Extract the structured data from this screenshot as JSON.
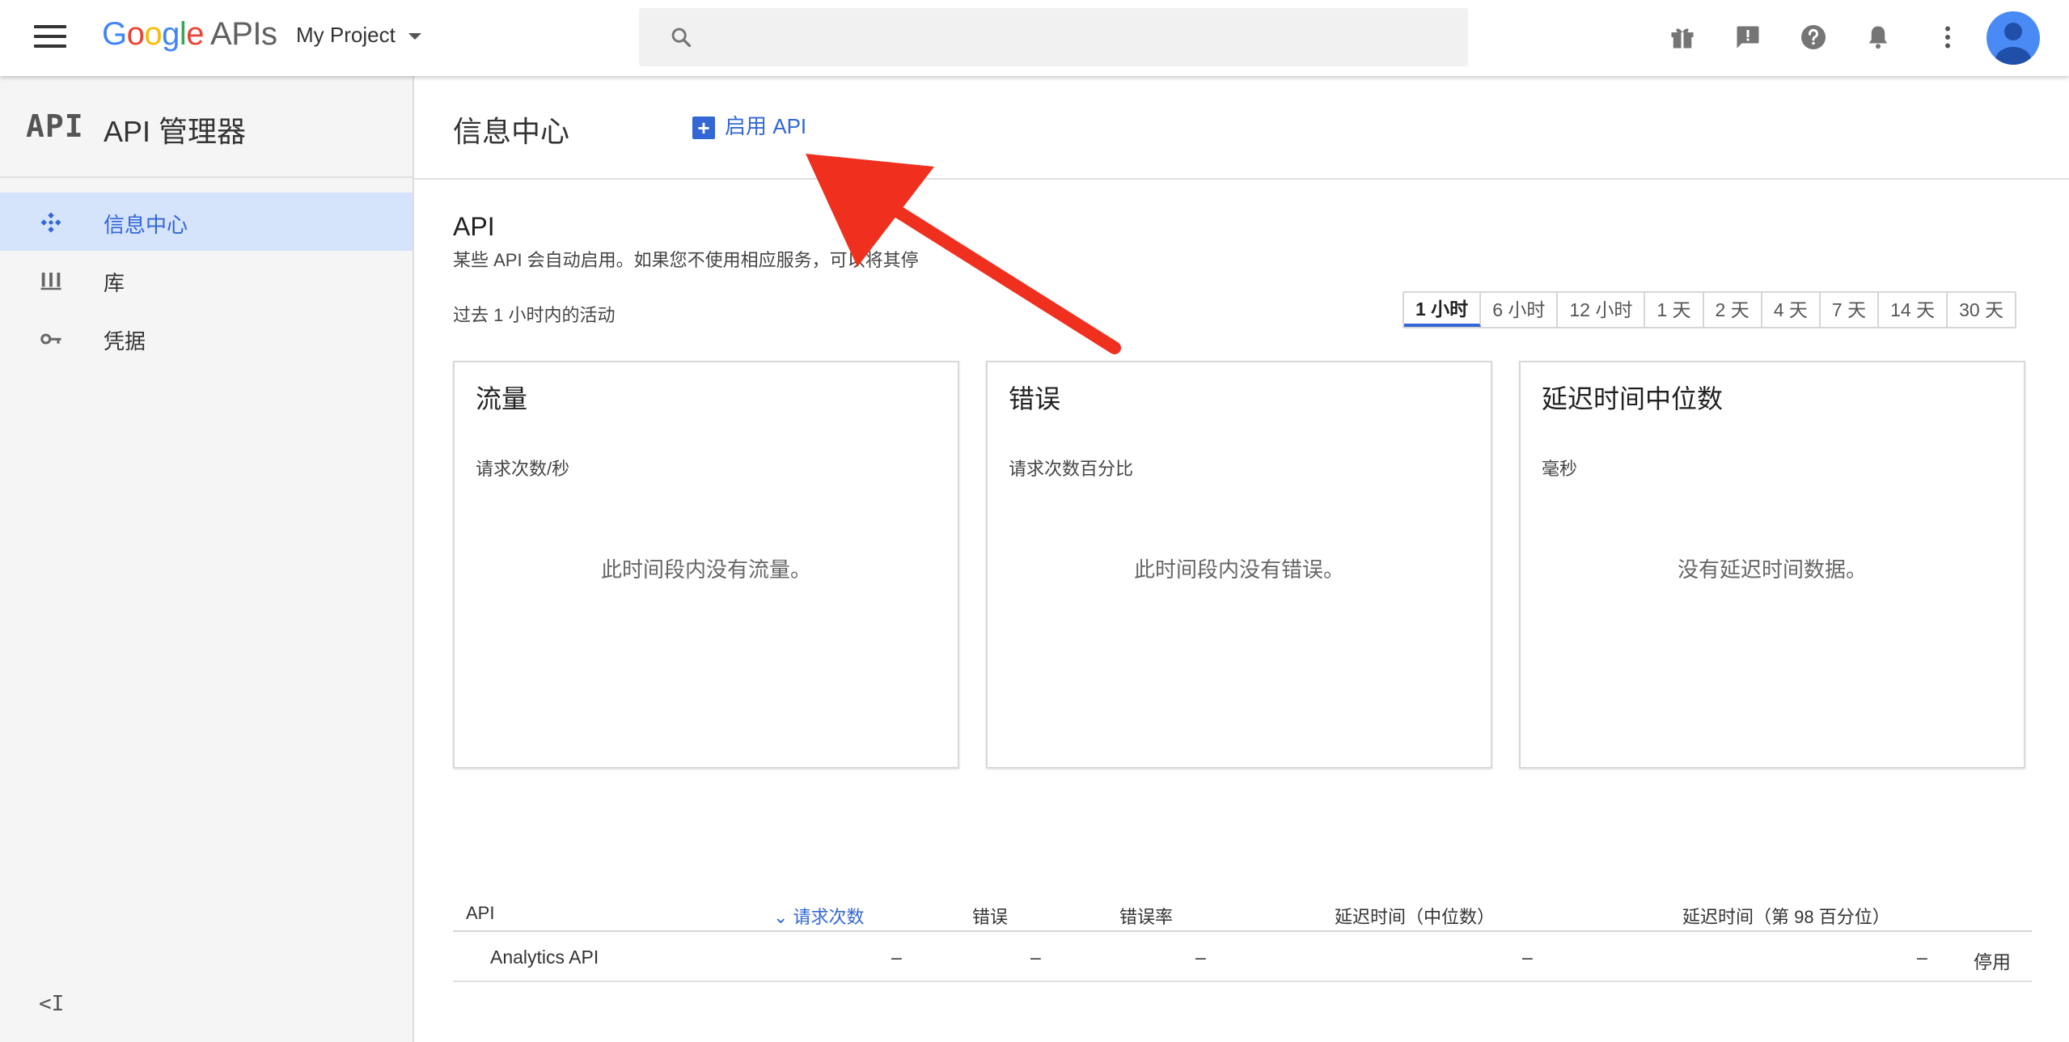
{
  "topbar": {
    "logo_google": "Google",
    "logo_apis": "APIs",
    "project_name": "My Project",
    "search_placeholder": "",
    "icons": [
      "gift-icon",
      "feedback-icon",
      "help-icon",
      "notifications-icon",
      "more-vert-icon",
      "account-icon"
    ]
  },
  "sidebar": {
    "api_badge": "API",
    "title": "API 管理器",
    "items": [
      {
        "label": "信息中心",
        "icon": "dashboard-icon",
        "active": true
      },
      {
        "label": "库",
        "icon": "library-icon",
        "active": false
      },
      {
        "label": "凭据",
        "icon": "key-icon",
        "active": false
      }
    ],
    "collapse_glyph": "<I"
  },
  "main": {
    "page_title": "信息中心",
    "enable_api_label": "启用 API",
    "section_title": "API",
    "section_subtitle": "某些 API 会自动启用。如果您不使用相应服务，可以将其停",
    "activity_label": "过去 1 小时内的活动",
    "time_ranges": [
      {
        "label": "1 小时",
        "active": true
      },
      {
        "label": "6 小时",
        "active": false
      },
      {
        "label": "12 小时",
        "active": false
      },
      {
        "label": "1 天",
        "active": false
      },
      {
        "label": "2 天",
        "active": false
      },
      {
        "label": "4 天",
        "active": false
      },
      {
        "label": "7 天",
        "active": false
      },
      {
        "label": "14 天",
        "active": false
      },
      {
        "label": "30 天",
        "active": false
      }
    ],
    "cards": [
      {
        "title": "流量",
        "subtitle": "请求次数/秒",
        "empty": "此时间段内没有流量。"
      },
      {
        "title": "错误",
        "subtitle": "请求次数百分比",
        "empty": "此时间段内没有错误。"
      },
      {
        "title": "延迟时间中位数",
        "subtitle": "毫秒",
        "empty": "没有延迟时间数据。"
      }
    ],
    "table": {
      "headers": {
        "api": "API",
        "requests": "请求次数",
        "errors": "错误",
        "error_rate": "错误率",
        "latency_median": "延迟时间（中位数）",
        "latency_98": "延迟时间（第 98 百分位）"
      },
      "rows": [
        {
          "api": "Analytics API",
          "requests": "–",
          "errors": "–",
          "error_rate": "–",
          "latency_median": "–",
          "latency_98": "–",
          "action": "停用"
        }
      ]
    }
  },
  "colors": {
    "accent": "#3367d6",
    "active_nav_bg": "#d5e3fb",
    "annotation_arrow": "#f0301f"
  }
}
